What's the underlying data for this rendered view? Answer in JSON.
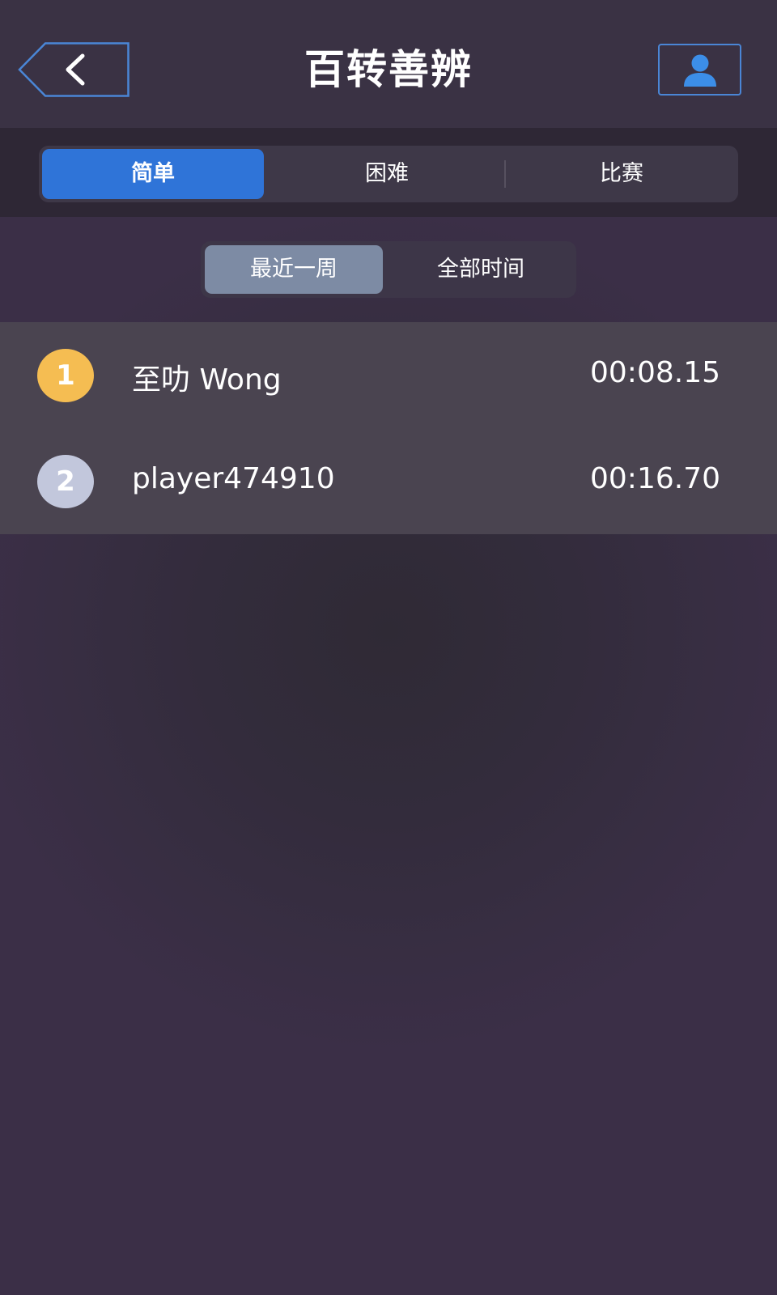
{
  "header": {
    "title": "百转善辨",
    "back_icon": "chevron-left-icon",
    "profile_icon": "user-icon",
    "accent_color": "#4a86d6"
  },
  "difficulty_tabs": {
    "items": [
      {
        "label": "简单",
        "active": true
      },
      {
        "label": "困难",
        "active": false
      },
      {
        "label": "比赛",
        "active": false
      }
    ],
    "active_color": "#2f74d8"
  },
  "time_range": {
    "items": [
      {
        "label": "最近一周",
        "active": true
      },
      {
        "label": "全部时间",
        "active": false
      }
    ],
    "active_color": "#7d8ba4"
  },
  "leaderboard": {
    "rows": [
      {
        "rank": "1",
        "name": "至叻 Wong",
        "time": "00:08.15",
        "badge_color": "#f5bd52"
      },
      {
        "rank": "2",
        "name": "player474910",
        "time": "00:16.70",
        "badge_color": "#c2c7dc"
      }
    ]
  }
}
